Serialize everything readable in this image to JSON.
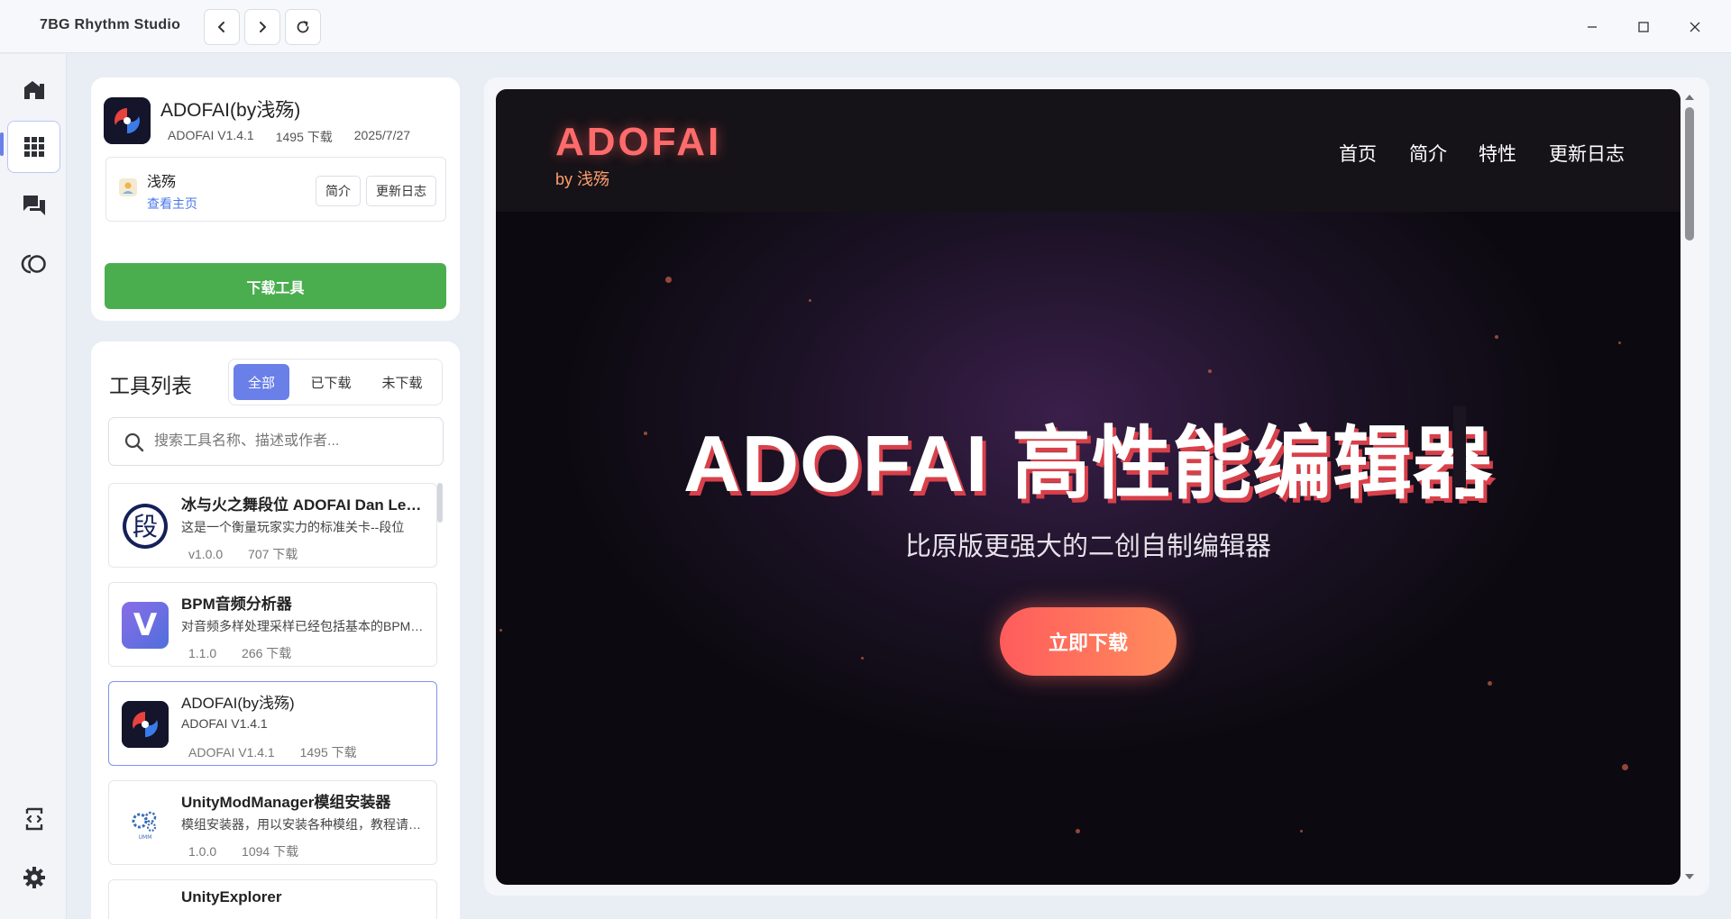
{
  "window": {
    "title": "7BG Rhythm Studio",
    "back_icon": "chevron-left-icon",
    "forward_icon": "chevron-right-icon",
    "refresh_icon": "refresh-icon"
  },
  "sidebar": {
    "items": [
      {
        "name": "home",
        "icon": "home-icon"
      },
      {
        "name": "apps",
        "icon": "grid-icon",
        "active": true
      },
      {
        "name": "chat",
        "icon": "chat-icon"
      },
      {
        "name": "sync",
        "icon": "circles-icon"
      }
    ],
    "bottom": [
      {
        "name": "extensions",
        "icon": "code-frame-icon"
      },
      {
        "name": "settings",
        "icon": "gear-icon"
      }
    ]
  },
  "selected_tool": {
    "name": "ADOFAI(by浅殇)",
    "version": "ADOFAI V1.4.1",
    "downloads": "1495 下载",
    "date": "2025/7/27",
    "author": "浅殇",
    "author_link": "查看主页",
    "intro_button": "简介",
    "changelog_button": "更新日志",
    "download_button": "下载工具"
  },
  "tool_list": {
    "title": "工具列表",
    "filters": [
      "全部",
      "已下载",
      "未下载"
    ],
    "active_filter": 0,
    "search_placeholder": "搜索工具名称、描述或作者...",
    "items": [
      {
        "name": "冰与火之舞段位 ADOFAI Dan Levels",
        "desc": "这是一个衡量玩家实力的标准关卡--段位",
        "version": "v1.0.0",
        "downloads": "707 下载",
        "icon_text": "段"
      },
      {
        "name": "BPM音频分析器",
        "desc": "对音频多样处理采样已经包括基本的BPM分析",
        "version": "1.1.0",
        "downloads": "266 下载",
        "icon_text": "V"
      },
      {
        "name": "ADOFAI(by浅殇)",
        "desc": "ADOFAI V1.4.1",
        "version": "ADOFAI V1.4.1",
        "downloads": "1495 下载",
        "icon_text": ""
      },
      {
        "name": "UnityModManager模组安装器",
        "desc": "模组安装器，用以安装各种模组，教程请看简介",
        "version": "1.0.0",
        "downloads": "1094 下载",
        "icon_text": "UMM"
      },
      {
        "name": "UnityExplorer",
        "desc": "",
        "version": "",
        "downloads": "",
        "icon_text": ""
      }
    ]
  },
  "preview": {
    "brand": "ADOFAI",
    "brand_sub": "by 浅殇",
    "nav": [
      "首页",
      "简介",
      "特性",
      "更新日志"
    ],
    "hero": "ADOFAI 高性能编辑器",
    "tagline": "比原版更强大的二创自制编辑器",
    "cta": "立即下载"
  },
  "colors": {
    "accent": "#6a7fe8",
    "download_green": "#4aae4f",
    "brand_red": "#ff6b6b",
    "cta_gradient_start": "#ff5c5c",
    "cta_gradient_end": "#ff8c5c"
  }
}
